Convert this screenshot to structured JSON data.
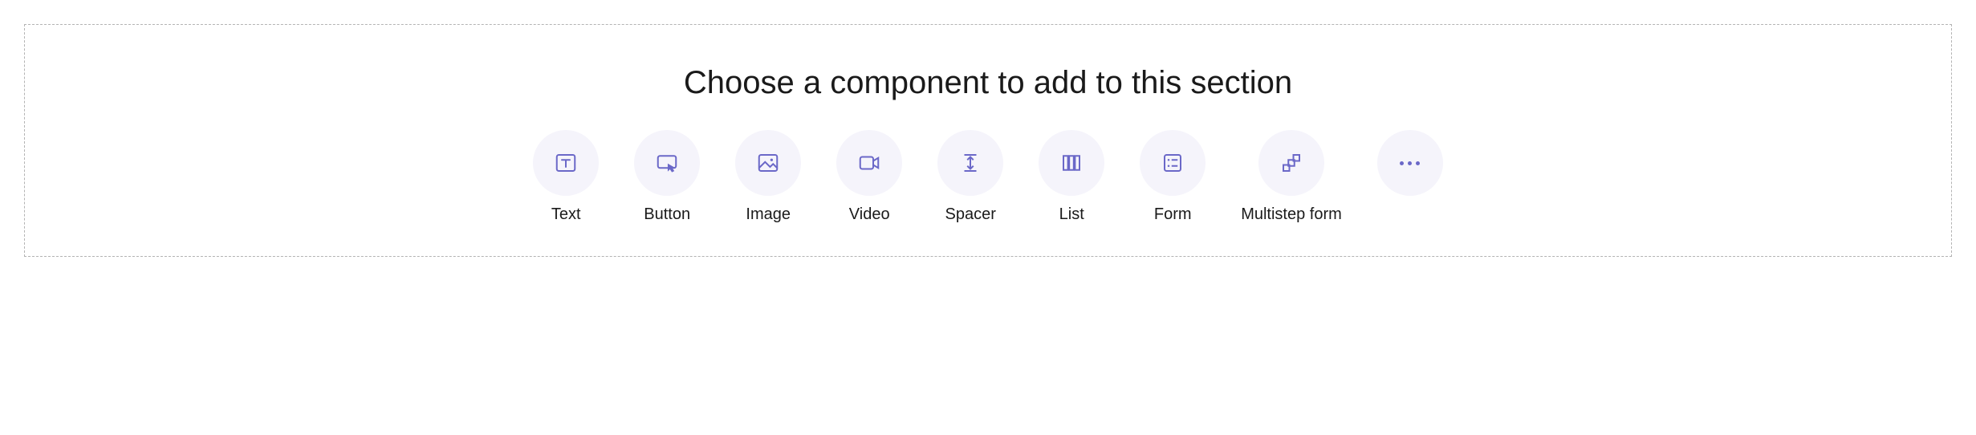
{
  "title": "Choose a component to add to this section",
  "components": {
    "text": {
      "label": "Text"
    },
    "button": {
      "label": "Button"
    },
    "image": {
      "label": "Image"
    },
    "video": {
      "label": "Video"
    },
    "spacer": {
      "label": "Spacer"
    },
    "list": {
      "label": "List"
    },
    "form": {
      "label": "Form"
    },
    "multistep_form": {
      "label": "Multistep form"
    }
  },
  "colors": {
    "icon_bg": "#f5f4fb",
    "icon_stroke": "#6B68C8",
    "border": "#b3b3b3"
  }
}
